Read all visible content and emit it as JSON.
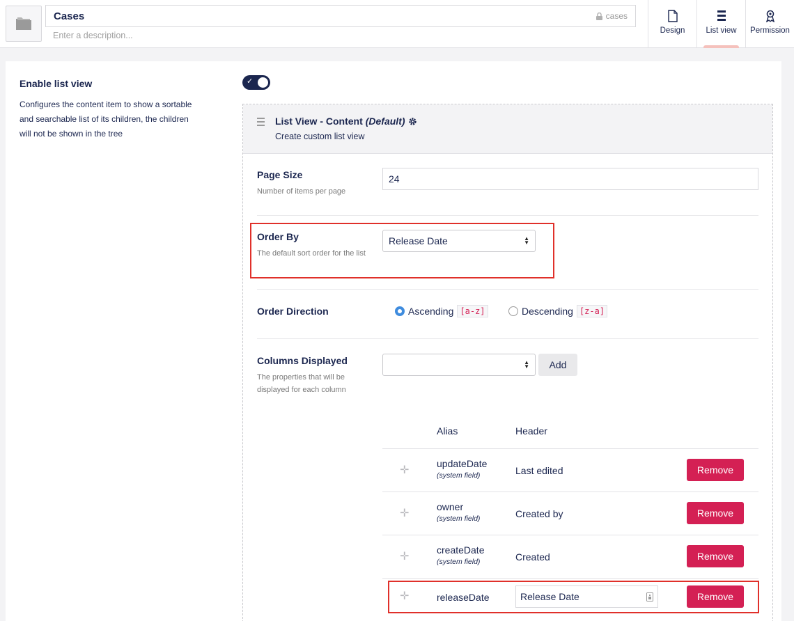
{
  "header": {
    "name": "Cases",
    "alias": "cases",
    "description_placeholder": "Enter a description...",
    "tabs": [
      {
        "label": "Design",
        "icon": "document-icon"
      },
      {
        "label": "List view",
        "icon": "list-icon",
        "active": true
      },
      {
        "label": "Permission",
        "icon": "permission-icon"
      }
    ]
  },
  "settings": {
    "title": "Enable list view",
    "description": "Configures the content item to show a sortable and searchable list of its children, the children will not be shown in the tree",
    "enabled": true
  },
  "list_view": {
    "title": "List View - Content",
    "default_label": "(Default)",
    "link": "Create custom list view",
    "page_size": {
      "label": "Page Size",
      "description": "Number of items per page",
      "value": "24"
    },
    "order_by": {
      "label": "Order By",
      "description": "The default sort order for the list",
      "value": "Release Date"
    },
    "order_direction": {
      "label": "Order Direction",
      "options": [
        {
          "label": "Ascending",
          "code": "[a-z]",
          "selected": true
        },
        {
          "label": "Descending",
          "code": "[z-a]",
          "selected": false
        }
      ]
    },
    "columns": {
      "label": "Columns Displayed",
      "description": "The properties that will be displayed for each column",
      "select_value": "",
      "add_label": "Add",
      "headers": {
        "alias": "Alias",
        "header": "Header"
      },
      "remove_label": "Remove",
      "rows": [
        {
          "alias": "updateDate",
          "system": "(system field)",
          "header": "Last edited"
        },
        {
          "alias": "owner",
          "system": "(system field)",
          "header": "Created by"
        },
        {
          "alias": "createDate",
          "system": "(system field)",
          "header": "Created"
        },
        {
          "alias": "releaseDate",
          "system": "",
          "header": "Release Date"
        }
      ]
    }
  },
  "colors": {
    "text": "#1b264f",
    "remove": "#d42054",
    "highlight": "#e0302a",
    "radio": "#3f8cde"
  }
}
